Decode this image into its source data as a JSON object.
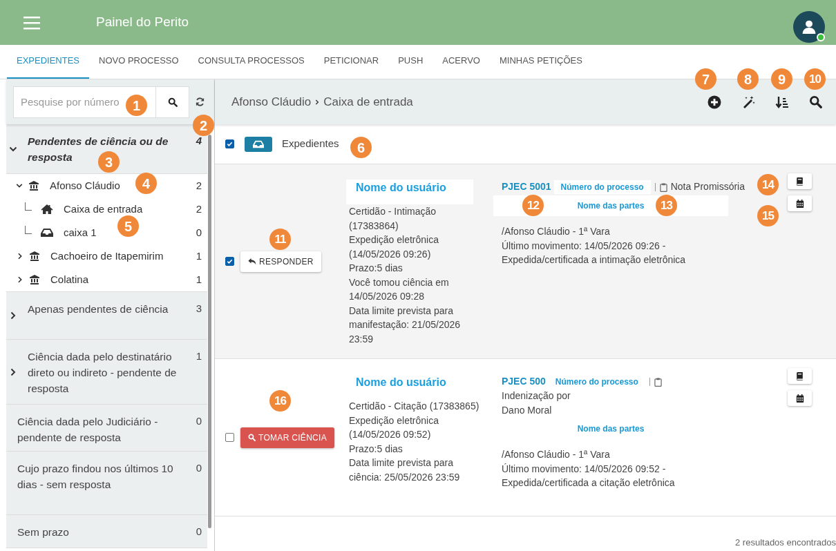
{
  "header": {
    "title": "Painel do Perito"
  },
  "tabs": [
    {
      "label": "EXPEDIENTES",
      "selected": true
    },
    {
      "label": "NOVO PROCESSO",
      "selected": false
    },
    {
      "label": "CONSULTA PROCESSOS",
      "selected": false
    },
    {
      "label": "PETICIONAR",
      "selected": false
    },
    {
      "label": "PUSH",
      "selected": false
    },
    {
      "label": "ACERVO",
      "selected": false
    },
    {
      "label": "MINHAS PETIÇÕES",
      "selected": false
    }
  ],
  "search": {
    "placeholder": "Pesquise por número"
  },
  "sidebar": [
    {
      "kind": "expandable",
      "label": "Pendentes de ciência ou de resposta",
      "count": "4",
      "selected": true,
      "expanded": true,
      "children": [
        {
          "kind": "court",
          "label": "Afonso Cláudio",
          "count": "2",
          "expanded": true,
          "children": [
            {
              "kind": "home",
              "label": "Caixa de entrada",
              "count": "2"
            },
            {
              "kind": "inbox",
              "label": "caixa 1",
              "count": "0"
            }
          ]
        },
        {
          "kind": "court",
          "label": "Cachoeiro de Itapemirim",
          "count": "1",
          "expanded": false
        },
        {
          "kind": "court",
          "label": "Colatina",
          "count": "1",
          "expanded": false
        }
      ]
    },
    {
      "kind": "expandable",
      "label": "Apenas pendentes de ciência",
      "count": "3",
      "selected": false,
      "expanded": false
    },
    {
      "kind": "expandable",
      "label": "Ciência dada pelo destinatário direto ou indireto - pendente de resposta",
      "count": "1",
      "selected": false,
      "expanded": false
    },
    {
      "kind": "leaf",
      "label": "Ciência dada pelo Judiciário - pendente de resposta",
      "count": "0",
      "selected": false
    },
    {
      "kind": "leaf",
      "label": "Cujo prazo findou nos últimos 10 dias - sem resposta",
      "count": "0",
      "selected": false
    },
    {
      "kind": "leaf",
      "label": "Sem prazo",
      "count": "0",
      "selected": false
    }
  ],
  "breadcrumb": [
    "Afonso Cláudio",
    "Caixa de entrada"
  ],
  "list_header": {
    "label": "Expedientes",
    "checked": true
  },
  "items": [
    {
      "checked": true,
      "action": {
        "kind": "respond",
        "label": "RESPONDER"
      },
      "user": "Nome do usuário",
      "details": [
        "Certidão - Intimação (17383864)",
        "Expedição eletrônica (14/05/2026 09:26)",
        "Prazo:5 dias",
        "Você tomou ciência em 14/05/2026 09:28",
        "Data limite prevista para manifestação: 21/05/2026 23:59"
      ],
      "process_number": "PJEC 5001",
      "process_label": "Número do processo",
      "subject": "Nota Promissória",
      "parties": "Nome das partes",
      "location": "/Afonso Cláudio - 1ª Vara",
      "movement": "Último movimento: 14/05/2026 09:26 - Expedida/certificada a intimação eletrônica"
    },
    {
      "checked": false,
      "action": {
        "kind": "acknowledge",
        "label": "TOMAR CIÊNCIA"
      },
      "user": "Nome do usuário",
      "details": [
        "Certidão - Citação (17383865)",
        "Expedição eletrônica (14/05/2026 09:52)",
        "Prazo:5 dias",
        "Data limite prevista para ciência: 25/05/2026 23:59"
      ],
      "process_number": "PJEC 500",
      "process_label": "Número do processo",
      "subject": "Indenização por Dano Moral",
      "parties": "Nome das partes",
      "location": "/Afonso Cláudio - 1ª Vara",
      "movement": "Último movimento: 14/05/2026 09:52 - Expedida/certificada a citação eletrônica"
    }
  ],
  "footer": "2 resultados encontrados",
  "annotations": [
    "1",
    "2",
    "3",
    "4",
    "5",
    "6",
    "7",
    "8",
    "9",
    "10",
    "11",
    "12",
    "13",
    "14",
    "15",
    "16"
  ]
}
